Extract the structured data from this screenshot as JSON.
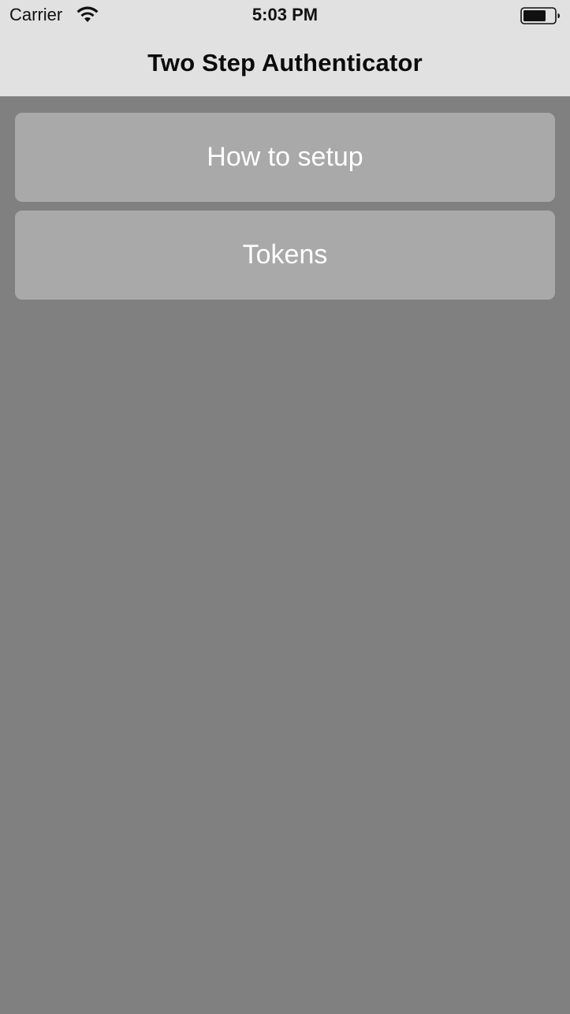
{
  "status_bar": {
    "carrier": "Carrier",
    "time": "5:03 PM",
    "wifi_icon": "wifi-icon",
    "battery_icon": "battery-icon"
  },
  "nav_bar": {
    "title": "Two Step Authenticator"
  },
  "menu": {
    "items": [
      {
        "label": "How to setup"
      },
      {
        "label": "Tokens"
      }
    ]
  },
  "colors": {
    "background": "#808080",
    "bar": "#e1e1e1",
    "button": "#a9a9a9",
    "button_text": "#ffffff"
  }
}
